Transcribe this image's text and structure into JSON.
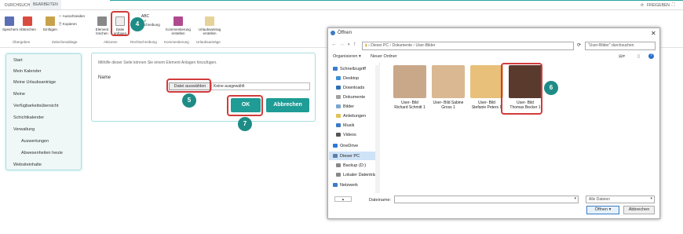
{
  "tabs": {
    "browse": "DURCHSUCHEN",
    "edit": "BEARBEITEN"
  },
  "topright": {
    "share": "FREIGEBEN"
  },
  "ribbon": {
    "save": "Speichern",
    "cancel": "Abbrechen",
    "paste": "Einfügen",
    "cut": "Ausschneiden",
    "copy": "Kopieren",
    "delete_item": "Element löschen",
    "attach_file": "Datei anfügen",
    "spelling": "Rechtschreibung",
    "abc": "ABC",
    "manage_perms": "Kommentierung erstellen",
    "vacation": "Urlaubsantrag erstellen",
    "grp_commit": "Übergeben",
    "grp_clipboard": "Zwischenablage",
    "grp_actions": "Aktionen",
    "grp_spelling": "Rechtschreibung",
    "grp_comment": "Kommentierung",
    "grp_vacation": "Urlaubsanträge"
  },
  "callouts": {
    "c4": "4",
    "c5": "5",
    "c6": "6",
    "c7": "7"
  },
  "nav": [
    "Start",
    "Mein Kalender",
    "Meine Urlaubsanträge",
    "Meine",
    "Verfügbarkeitsübersicht",
    "Schichtkalender",
    "Verwaltung",
    "Auswertungen",
    "Abwesenheiten heute",
    "Websiteinhalte"
  ],
  "form": {
    "hint": "Mithilfe dieser Seite können Sie einem Element Anlagen hinzufügen.",
    "name_label": "Name",
    "choose_file": "Datei auswählen",
    "no_file": "Keine ausgewählt",
    "ok": "OK",
    "cancel": "Abbrechen"
  },
  "dialog": {
    "title": "Öffnen",
    "crumbs": [
      "Dieser PC",
      "Dokumente",
      "User-Bilder"
    ],
    "search_placeholder": "\"User-Bilder\" durchsuchen",
    "organize": "Organisieren ▾",
    "new_folder": "Neuer Ordner",
    "sidebar": [
      "Schnellzugriff",
      "Desktop",
      "Downloads",
      "Dokumente",
      "Bilder",
      "Anleitungen",
      "Musik",
      "Videos",
      "OneDrive",
      "Dieser PC",
      "Backup (D:)",
      "Lokaler Datenträg",
      "Netzwerk"
    ],
    "files": [
      {
        "line1": "User- Bild",
        "line2": "Richard Schmitt 1",
        "color": "#c9a88a"
      },
      {
        "line1": "User- Bild Sabine",
        "line2": "Gross 1",
        "color": "#d9b892"
      },
      {
        "line1": "User- Bild",
        "line2": "Stefanie Peters 1",
        "color": "#e8c07a"
      },
      {
        "line1": "User- Bild",
        "line2": "Thomas Becker 1",
        "color": "#5b3a2e"
      }
    ],
    "filename_label": "Dateiname:",
    "filter": "Alle Dateien",
    "open": "Öffnen",
    "cancel": "Abbrechen"
  },
  "colors": {
    "teal": "#1e9c95",
    "red": "#d23b3b"
  }
}
